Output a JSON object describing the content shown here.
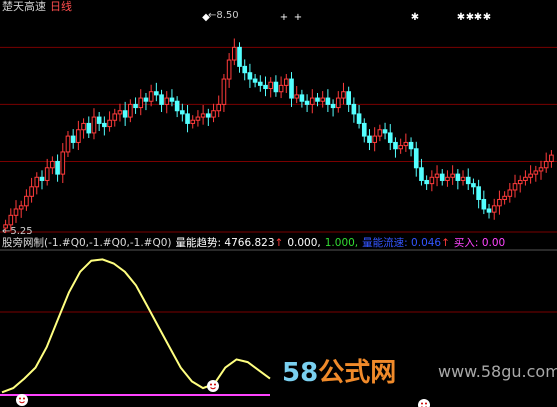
{
  "header": {
    "name": "楚天高速",
    "period": "日线"
  },
  "price_labels": {
    "high": "8.50",
    "low": "5.25"
  },
  "indicator": {
    "name": "股旁网制",
    "params": "(-1.#Q0,-1.#Q0,-1.#Q0)",
    "items": [
      {
        "label": "量能趋势:",
        "value": "4766.823",
        "arrow": "↑",
        "color": "#ffffff"
      },
      {
        "label": "",
        "value": "0.000,",
        "arrow": "",
        "color": "#ffffff"
      },
      {
        "label": "",
        "value": "1.000,",
        "arrow": "",
        "color": "#33dd33"
      },
      {
        "label": "量能流速:",
        "value": "0.046",
        "arrow": "↑",
        "color": "#3355ff"
      },
      {
        "label": "买入:",
        "value": "0.00",
        "arrow": "",
        "color": "#ff44ff"
      }
    ]
  },
  "watermark": {
    "brand_a": "58",
    "brand_b": "公式网",
    "url": "www.58gu.com"
  },
  "colors": {
    "up": "#ff3b3b",
    "down": "#54ffff",
    "grid": "#7a0000",
    "curve": "#ffff80",
    "baseline": "#ff44ff"
  },
  "chart_data": {
    "type": "candlestick",
    "price_range": [
      5.25,
      8.5
    ],
    "closes": [
      5.3,
      5.45,
      5.55,
      5.6,
      5.75,
      5.9,
      6.05,
      6.0,
      6.2,
      6.3,
      6.1,
      6.45,
      6.7,
      6.6,
      6.8,
      6.9,
      6.75,
      7.0,
      6.9,
      6.85,
      6.95,
      7.05,
      7.1,
      7.0,
      7.2,
      7.15,
      7.3,
      7.25,
      7.4,
      7.35,
      7.2,
      7.3,
      7.25,
      7.1,
      7.05,
      6.9,
      6.95,
      7.0,
      7.05,
      7.0,
      7.1,
      7.2,
      7.6,
      7.9,
      8.1,
      7.8,
      7.7,
      7.6,
      7.55,
      7.5,
      7.45,
      7.55,
      7.4,
      7.5,
      7.6,
      7.3,
      7.35,
      7.25,
      7.2,
      7.3,
      7.25,
      7.3,
      7.2,
      7.15,
      7.3,
      7.4,
      7.2,
      7.05,
      6.9,
      6.7,
      6.6,
      6.7,
      6.8,
      6.75,
      6.6,
      6.5,
      6.55,
      6.6,
      6.5,
      6.2,
      6.0,
      5.95,
      6.05,
      6.1,
      6.0,
      6.05,
      6.1,
      6.0,
      6.05,
      5.95,
      5.9,
      5.7,
      5.55,
      5.5,
      5.6,
      5.7,
      5.75,
      5.85,
      5.95,
      6.0,
      6.05,
      6.1,
      6.15,
      6.2,
      6.3,
      6.4
    ],
    "indicator_curve": [
      0.02,
      0.05,
      0.12,
      0.2,
      0.35,
      0.55,
      0.75,
      0.9,
      0.98,
      0.99,
      0.96,
      0.9,
      0.8,
      0.65,
      0.5,
      0.35,
      0.2,
      0.1,
      0.05,
      0.08,
      0.2,
      0.26,
      0.24,
      0.18,
      0.12
    ],
    "markers": [
      "◆",
      "+",
      "+",
      "✱",
      "✱",
      "✱",
      "✱",
      "✱"
    ]
  }
}
